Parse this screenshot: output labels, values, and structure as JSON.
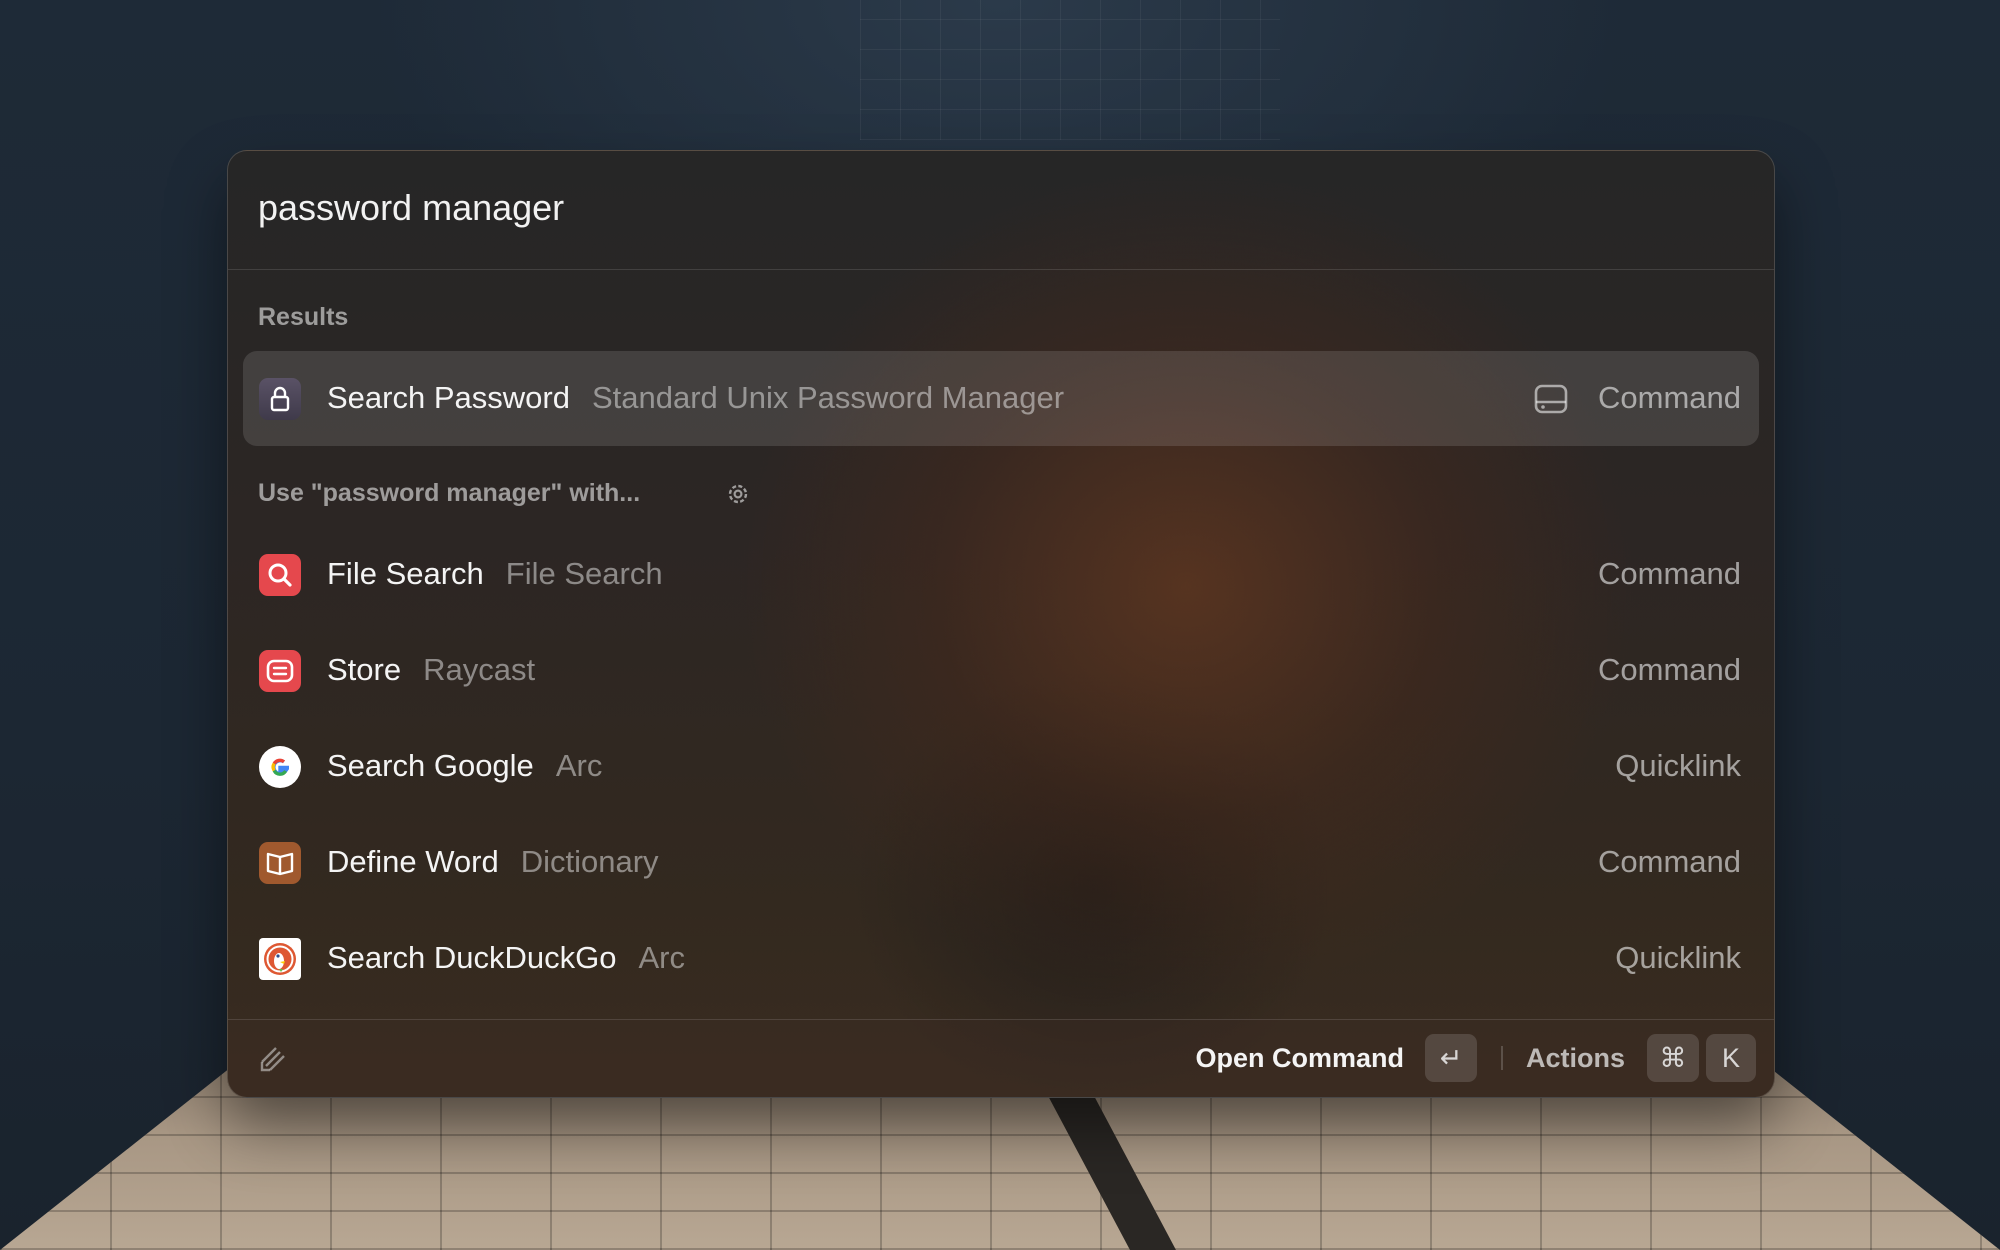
{
  "search": {
    "value": "password manager"
  },
  "sections": {
    "results_label": "Results",
    "fallback_label": "Use \"password manager\" with..."
  },
  "results": [
    {
      "title": "Search Password",
      "subtitle": "Standard Unix Password Manager",
      "kind": "Command",
      "icon": "lock-icon",
      "kind_icon": "hard-drive-icon",
      "selected": true
    }
  ],
  "fallbacks": [
    {
      "title": "File Search",
      "subtitle": "File Search",
      "kind": "Command",
      "icon": "magnifier-icon",
      "color": "#e5484d"
    },
    {
      "title": "Store",
      "subtitle": "Raycast",
      "kind": "Command",
      "icon": "store-icon",
      "color": "#e5484d"
    },
    {
      "title": "Search Google",
      "subtitle": "Arc",
      "kind": "Quicklink",
      "icon": "google-icon",
      "color": "#4285f4"
    },
    {
      "title": "Define Word",
      "subtitle": "Dictionary",
      "kind": "Command",
      "icon": "book-icon",
      "color": "#a0592e"
    },
    {
      "title": "Search DuckDuckGo",
      "subtitle": "Arc",
      "kind": "Quicklink",
      "icon": "duckduckgo-icon",
      "color": "#de5833"
    }
  ],
  "footer": {
    "primary_action": "Open Command",
    "primary_key": "↵",
    "actions_label": "Actions",
    "actions_keys": [
      "⌘",
      "K"
    ]
  }
}
